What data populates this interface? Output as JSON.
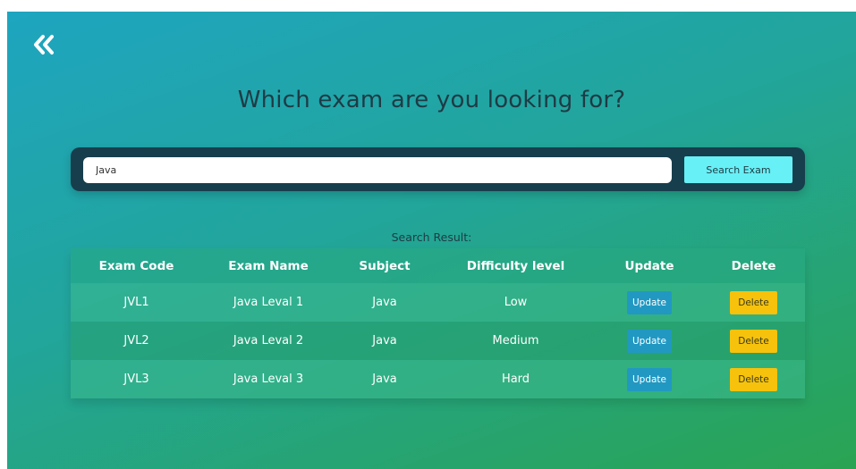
{
  "header": {
    "back_icon": "double-chevron-left-icon",
    "title": "Which exam are you looking for?"
  },
  "search": {
    "value": "Java",
    "button_label": "Search Exam"
  },
  "results": {
    "label": "Search Result:",
    "columns": [
      "Exam Code",
      "Exam Name",
      "Subject",
      "Difficulty level",
      "Update",
      "Delete"
    ],
    "rows": [
      {
        "code": "JVL1",
        "name": "Java Leval 1",
        "subject": "Java",
        "difficulty": "Low",
        "update_label": "Update",
        "delete_label": "Delete"
      },
      {
        "code": "JVL2",
        "name": "Java Leval 2",
        "subject": "Java",
        "difficulty": "Medium",
        "update_label": "Update",
        "delete_label": "Delete"
      },
      {
        "code": "JVL3",
        "name": "Java Leval 3",
        "subject": "Java",
        "difficulty": "Hard",
        "update_label": "Update",
        "delete_label": "Delete"
      }
    ]
  },
  "colors": {
    "search_button": "#67f0f5",
    "update_button": "#2198c2",
    "delete_button": "#f6c20c",
    "search_bar": "#173e4d",
    "title_text": "#1e3b45"
  }
}
